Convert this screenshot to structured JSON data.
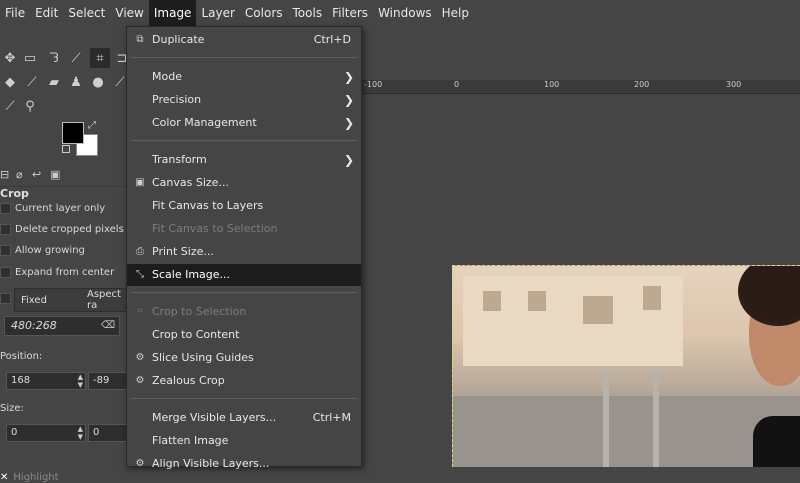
{
  "menubar": [
    "File",
    "Edit",
    "Select",
    "View",
    "Image",
    "Layer",
    "Colors",
    "Tools",
    "Filters",
    "Windows",
    "Help"
  ],
  "active_menu": "Image",
  "image_menu": {
    "duplicate": {
      "label": "Duplicate",
      "shortcut": "Ctrl+D"
    },
    "mode": "Mode",
    "precision": "Precision",
    "color_management": "Color Management",
    "transform": "Transform",
    "canvas_size": "Canvas Size...",
    "fit_canvas_layers": "Fit Canvas to Layers",
    "fit_canvas_selection": "Fit Canvas to Selection",
    "print_size": "Print Size...",
    "scale_image": "Scale Image...",
    "crop_selection": "Crop to Selection",
    "crop_content": "Crop to Content",
    "slice_guides": "Slice Using Guides",
    "zealous_crop": "Zealous Crop",
    "merge_visible": {
      "label": "Merge Visible Layers...",
      "shortcut": "Ctrl+M"
    },
    "flatten": "Flatten Image",
    "align_visible": "Align Visible Layers..."
  },
  "tool_options": {
    "title": "Crop",
    "current_layer_only": "Current layer only",
    "delete_cropped": "Delete cropped pixels",
    "allow_growing": "Allow growing",
    "expand_from_center": "Expand from center",
    "fixed": "Fixed",
    "aspect": "Aspect ra",
    "ratio": "480:268",
    "position_label": "Position:",
    "pos_x": "168",
    "pos_y": "-89",
    "size_label": "Size:",
    "size_w": "0",
    "size_h": "0",
    "highlight": "Highlight"
  },
  "ruler_ticks": [
    "-100",
    "0",
    "100",
    "200",
    "300"
  ],
  "colors": {
    "accent_fg": "#000000",
    "accent_bg": "#ffffff",
    "menu_bg": "#454545",
    "highlight_bg": "#1d1d1d"
  }
}
